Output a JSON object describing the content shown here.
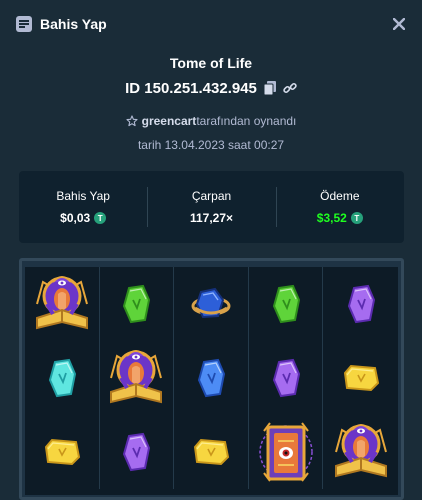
{
  "header": {
    "title": "Bahis Yap"
  },
  "game": {
    "title": "Tome of Life",
    "bet_id": "ID 150.251.432.945"
  },
  "player": {
    "username": "greencart",
    "suffix": "tarafından oynandı"
  },
  "date_line": "tarih 13.04.2023 saat 00:27",
  "stats": {
    "bet_label": "Bahis Yap",
    "bet_value": "$0,03",
    "multiplier_label": "Çarpan",
    "multiplier_value": "117,27×",
    "payout_label": "Ödeme",
    "payout_value": "$3,52",
    "coin_symbol": "T"
  },
  "colors": {
    "payout": "#1fff20",
    "coin": "#26a17b"
  },
  "reels": [
    [
      "priestess-wild",
      "green-rune",
      "blue-orb-ring",
      "green-rune",
      "purple-rune"
    ],
    [
      "cyan-rune",
      "priestess-wild",
      "blue-rune",
      "purple-rune",
      "yellow-rune"
    ],
    [
      "yellow-rune",
      "purple-rune",
      "yellow-rune",
      "tome-scatter",
      "priestess-wild"
    ]
  ]
}
